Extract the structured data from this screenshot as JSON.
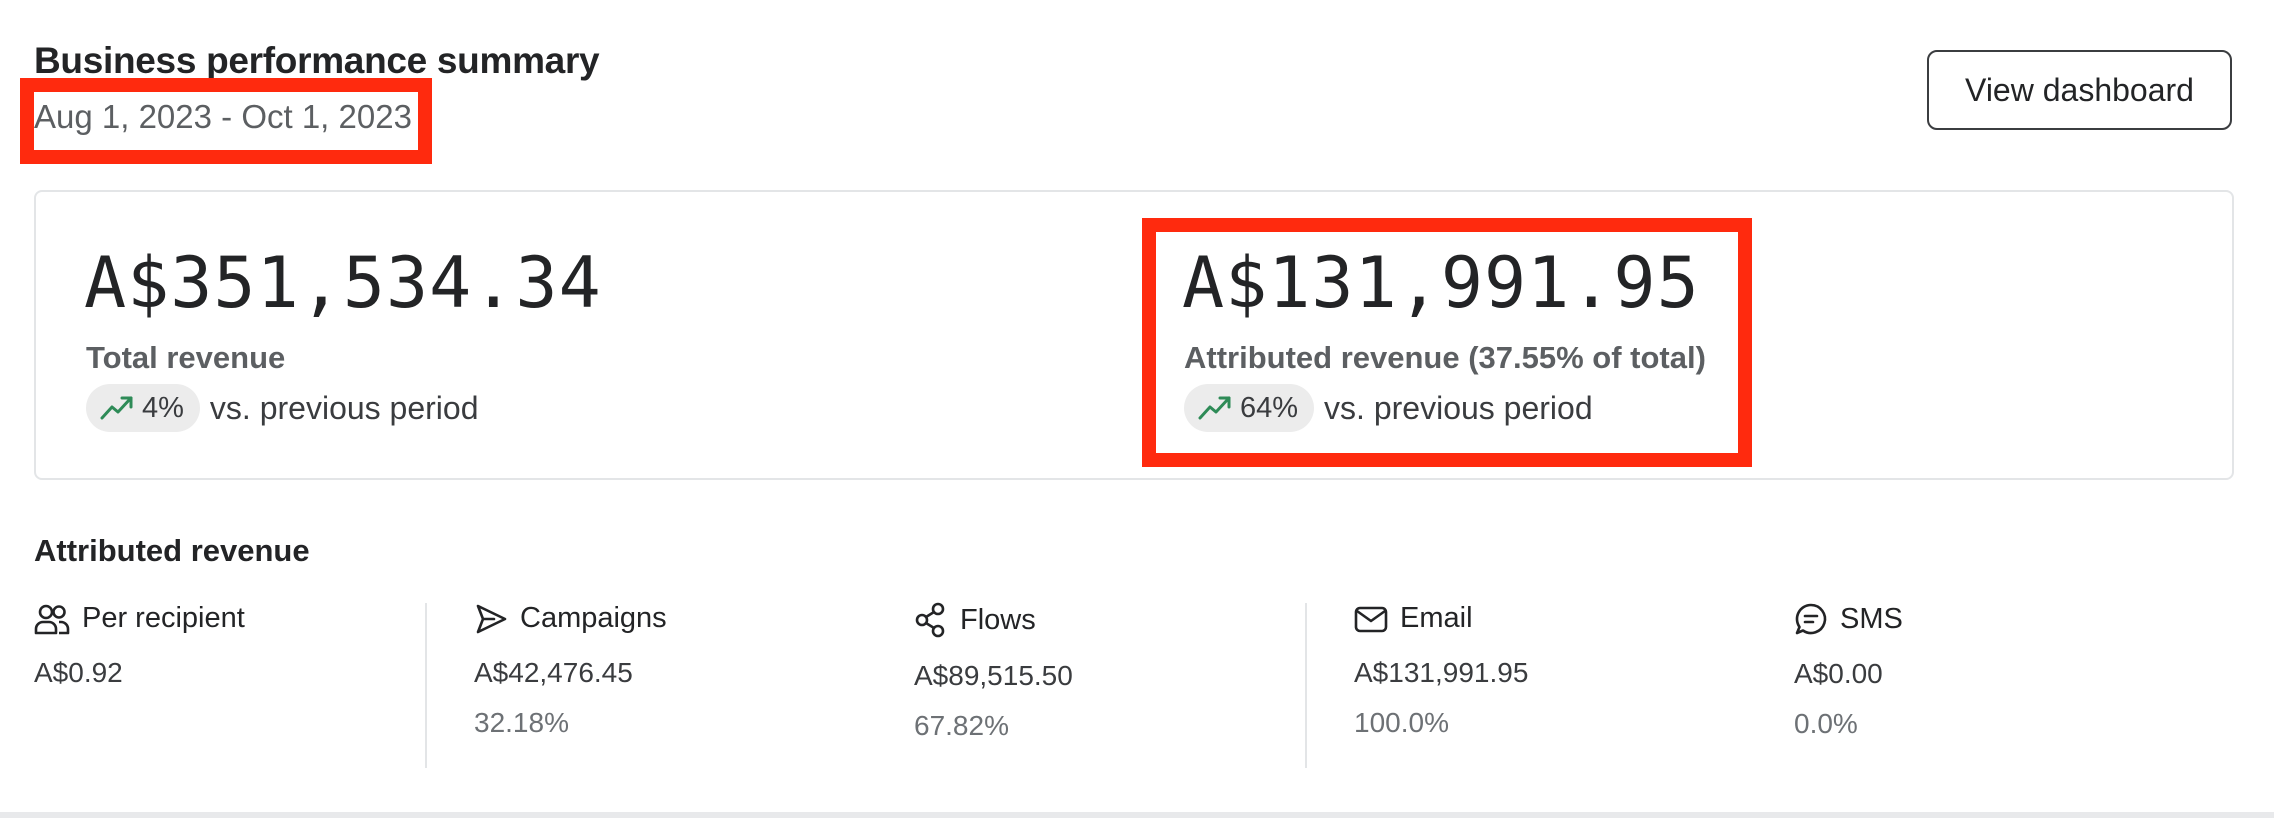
{
  "header": {
    "title": "Business performance summary",
    "date_range": "Aug 1, 2023 - Oct 1, 2023",
    "view_dashboard_label": "View dashboard"
  },
  "summary": {
    "total": {
      "amount": "A$351,534.34",
      "label": "Total revenue",
      "change": "4%",
      "change_icon": "trend-up-icon",
      "comparison": "vs. previous period"
    },
    "attributed": {
      "amount": "A$131,991.95",
      "label": "Attributed revenue (37.55% of total)",
      "change": "64%",
      "change_icon": "trend-up-icon",
      "comparison": "vs. previous period"
    }
  },
  "attributed_section": {
    "title": "Attributed revenue",
    "stats": [
      {
        "label": "Per recipient",
        "icon": "users-icon",
        "value": "A$0.92",
        "percent": ""
      },
      {
        "label": "Campaigns",
        "icon": "send-icon",
        "value": "A$42,476.45",
        "percent": "32.18%"
      },
      {
        "label": "Flows",
        "icon": "flow-icon",
        "value": "A$89,515.50",
        "percent": "67.82%"
      },
      {
        "label": "Email",
        "icon": "mail-icon",
        "value": "A$131,991.95",
        "percent": "100.0%"
      },
      {
        "label": "SMS",
        "icon": "chat-icon",
        "value": "A$0.00",
        "percent": "0.0%"
      }
    ]
  },
  "colors": {
    "highlight": "#ff2a0e",
    "trend_up": "#2e8b57",
    "border": "#e3e5e7",
    "text": "#232426",
    "muted": "#5c5f62"
  }
}
